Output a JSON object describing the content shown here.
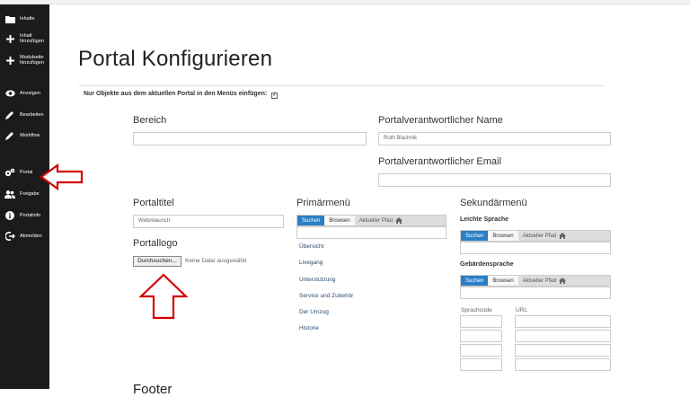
{
  "sidebar": {
    "items": [
      {
        "key": "inhalte",
        "label": "Inhalte",
        "icon": "folder-icon"
      },
      {
        "key": "inhalt-hinzufuegen",
        "label": "Inhalt hinzufügen",
        "icon": "plus-icon"
      },
      {
        "key": "modulseite-hinzufuegen",
        "label": "Modulseite hinzufügen",
        "icon": "plus-icon"
      },
      {
        "key": "anzeigen",
        "label": "Anzeigen",
        "icon": "eye-icon"
      },
      {
        "key": "bearbeiten",
        "label": "Bearbeiten",
        "icon": "pencil-icon"
      },
      {
        "key": "workflow",
        "label": "Workflow",
        "icon": "pencil-icon"
      },
      {
        "key": "portal",
        "label": "Portal",
        "icon": "gears-icon"
      },
      {
        "key": "freigabe",
        "label": "Freigabe",
        "icon": "users-icon"
      },
      {
        "key": "portalinfo",
        "label": "Portalinfo",
        "icon": "info-icon"
      },
      {
        "key": "abmelden",
        "label": "Abmelden",
        "icon": "logout-icon"
      }
    ]
  },
  "page": {
    "title": "Portal Konfigurieren",
    "note": "Nur Objekte aus dem aktuellen Portal in den Menüs einfügen:"
  },
  "form": {
    "bereich_label": "Bereich",
    "bereich_value": "",
    "verantwortlicher_name_label": "Portalverantwortlicher Name",
    "verantwortlicher_name_value": "Ruth Blachnik",
    "verantwortlicher_email_label": "Portalverantwortlicher Email",
    "verantwortlicher_email_value": "",
    "portaltitel_label": "Portaltitel",
    "portaltitel_value": "Webrelaunch",
    "portallogo_label": "Portallogo",
    "file_button": "Durchsuchen...",
    "file_status": "Keine Datei ausgewählt",
    "footer_label": "Footer"
  },
  "primaermenu": {
    "label": "Primärmenü",
    "seg": {
      "suchen": "Suchen",
      "browsen": "Browsen",
      "aktueller": "Aktueller Pfad"
    },
    "links": [
      "Übersicht",
      "Livegang",
      "Unterstützung",
      "Service und Zubehör",
      "Der Umzug",
      "Historie"
    ]
  },
  "sekundaermenu": {
    "label": "Sekundärmenü",
    "leichte_sprache": "Leichte Sprache",
    "gebaerdensprache": "Gebärdensprache",
    "seg": {
      "suchen": "Suchen",
      "browsen": "Browsen",
      "aktueller": "Aktueller Pfad"
    },
    "sprachcode": "Sprachcode",
    "url": "URL"
  },
  "colors": {
    "sidebar": "#1b1b1b",
    "accent": "#2a7fc5",
    "arrow": "#d40000"
  }
}
